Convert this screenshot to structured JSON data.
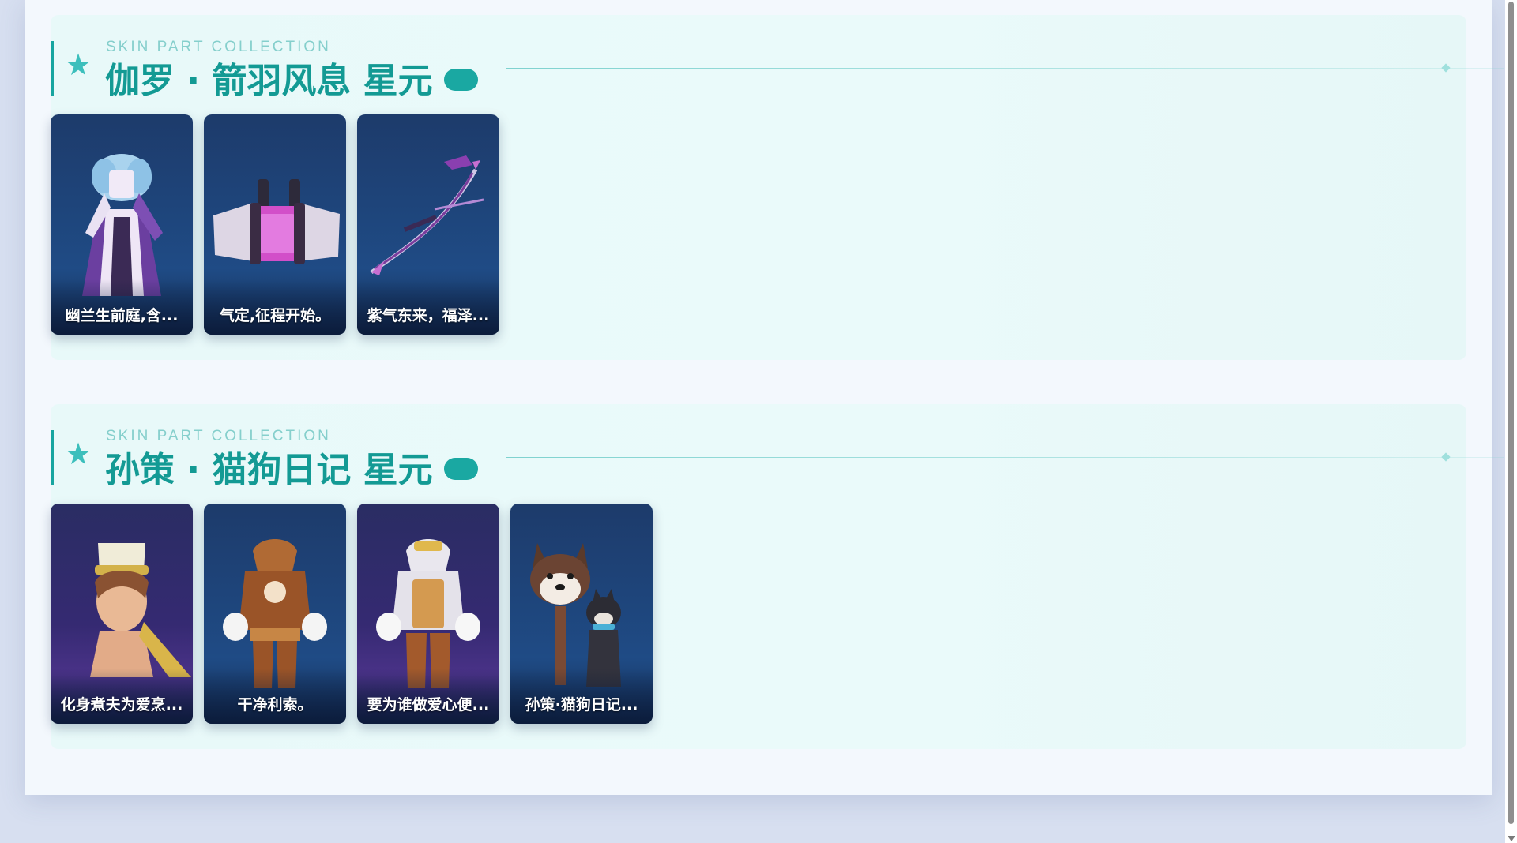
{
  "sections": [
    {
      "subtitle": "SKIN PART COLLECTION",
      "title": "伽罗 · 箭羽风息 星元",
      "cards": [
        {
          "label": "幽兰生前庭,含...",
          "icon": "outfit-costume-icon"
        },
        {
          "label": "气定,征程开始。",
          "icon": "backpack-quiver-icon"
        },
        {
          "label": "紫气东来，福泽...",
          "icon": "bow-weapon-icon"
        }
      ]
    },
    {
      "subtitle": "SKIN PART COLLECTION",
      "title": "孙策 · 猫狗日记 星元",
      "cards": [
        {
          "label": "化身煮夫为爱烹...",
          "icon": "hero-head-icon"
        },
        {
          "label": "干净利索。",
          "icon": "hoodie-outfit-icon"
        },
        {
          "label": "要为谁做爱心便...",
          "icon": "apron-outfit-icon"
        },
        {
          "label": "孙策·猫狗日记...",
          "icon": "dog-companion-icon"
        }
      ]
    }
  ],
  "colors": {
    "accent": "#139a94",
    "card_blue": "#1f4b85",
    "card_purple": "#352a72"
  }
}
